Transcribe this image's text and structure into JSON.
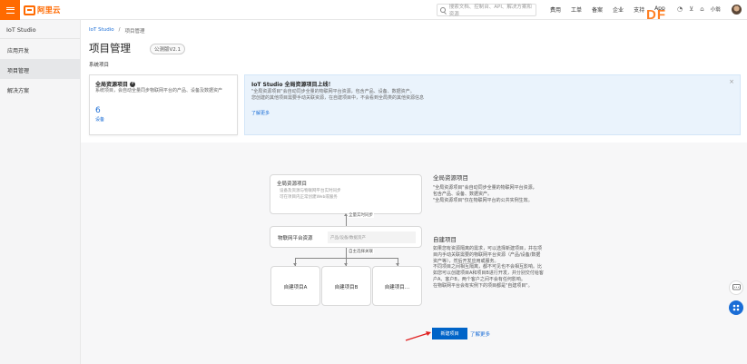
{
  "header": {
    "brand_name": "阿里云",
    "search_placeholder": "搜索文档、控制台、API、解决方案和资源",
    "nav": [
      "费用",
      "工单",
      "备案",
      "企业",
      "支持",
      "App"
    ],
    "username": "小翁",
    "watermark": "DF"
  },
  "sidebar": {
    "title": "IoT Studio",
    "items": [
      {
        "label": "应用开发",
        "active": false
      },
      {
        "label": "项目管理",
        "active": true
      },
      {
        "label": "解决方案",
        "active": false
      }
    ]
  },
  "breadcrumb": {
    "root": "IoT Studio",
    "separator": "/",
    "current": "项目管理"
  },
  "page": {
    "title": "项目管理",
    "version": "公测版V2.1",
    "section_label": "系统项目"
  },
  "global_card": {
    "title": "全局资源项目",
    "description": "系统项目，会自动全量同步物联网平台的产品、设备及数据资产",
    "count": "6",
    "unit": "设备"
  },
  "notice": {
    "title": "IoT Studio 全局资源项目上线！",
    "line1": "\"全局资源项目\"会自动同步全量的物联网平台资源，包含产品、设备、数据资产。",
    "line2": "您创建的其他项目需要手动关联资源，在自建项目中，不会看到全局类的其他资源信息",
    "link": "了解更多"
  },
  "diagram": {
    "top_title": "全局资源项目",
    "top_sub1": "设备及资源与物联网平台实时同步",
    "top_sub2": "可在项目内正常创建Web或服务",
    "edge_sync": "全量实时同步",
    "mid_label": "物联网平台资源",
    "mid_field": "产品/设备/数据资产",
    "edge_select": "自主选择关联",
    "sub_projects": [
      "自建项目A",
      "自建项目B",
      "自建项目…"
    ]
  },
  "explain": {
    "global_heading": "全局资源项目",
    "global_p1": "\"全局资源项目\"会自动同步全量的物联网平台资源，",
    "global_p2": "包含产品、设备、数据资产。",
    "global_p3": "\"全局资源项目\"仅在物联网平台的公共实例生效。",
    "self_heading": "自建项目",
    "self_lines": [
      "如果您有资源隔离的需求，可以选择新建项目，并在项",
      "目内手动关联需要的物联网平台资源（产品/设备/数据",
      "资产等），然后开发应用或服务。",
      "不同项目之间相互隔离，都不可见也不会相互影响。比",
      "如您可以创建项目A和项目B进行开发，并分别交付给客",
      "户A、客户B，两个客户之间不会有任何影响。",
      "在物联网平台会有实例下的项目都是\"自建项目\"。"
    ],
    "create_button": "新建项目",
    "learn_more": "了解更多"
  },
  "colors": {
    "brand": "#ff6a00",
    "primary": "#0064c8",
    "link": "#1a6dd6"
  }
}
